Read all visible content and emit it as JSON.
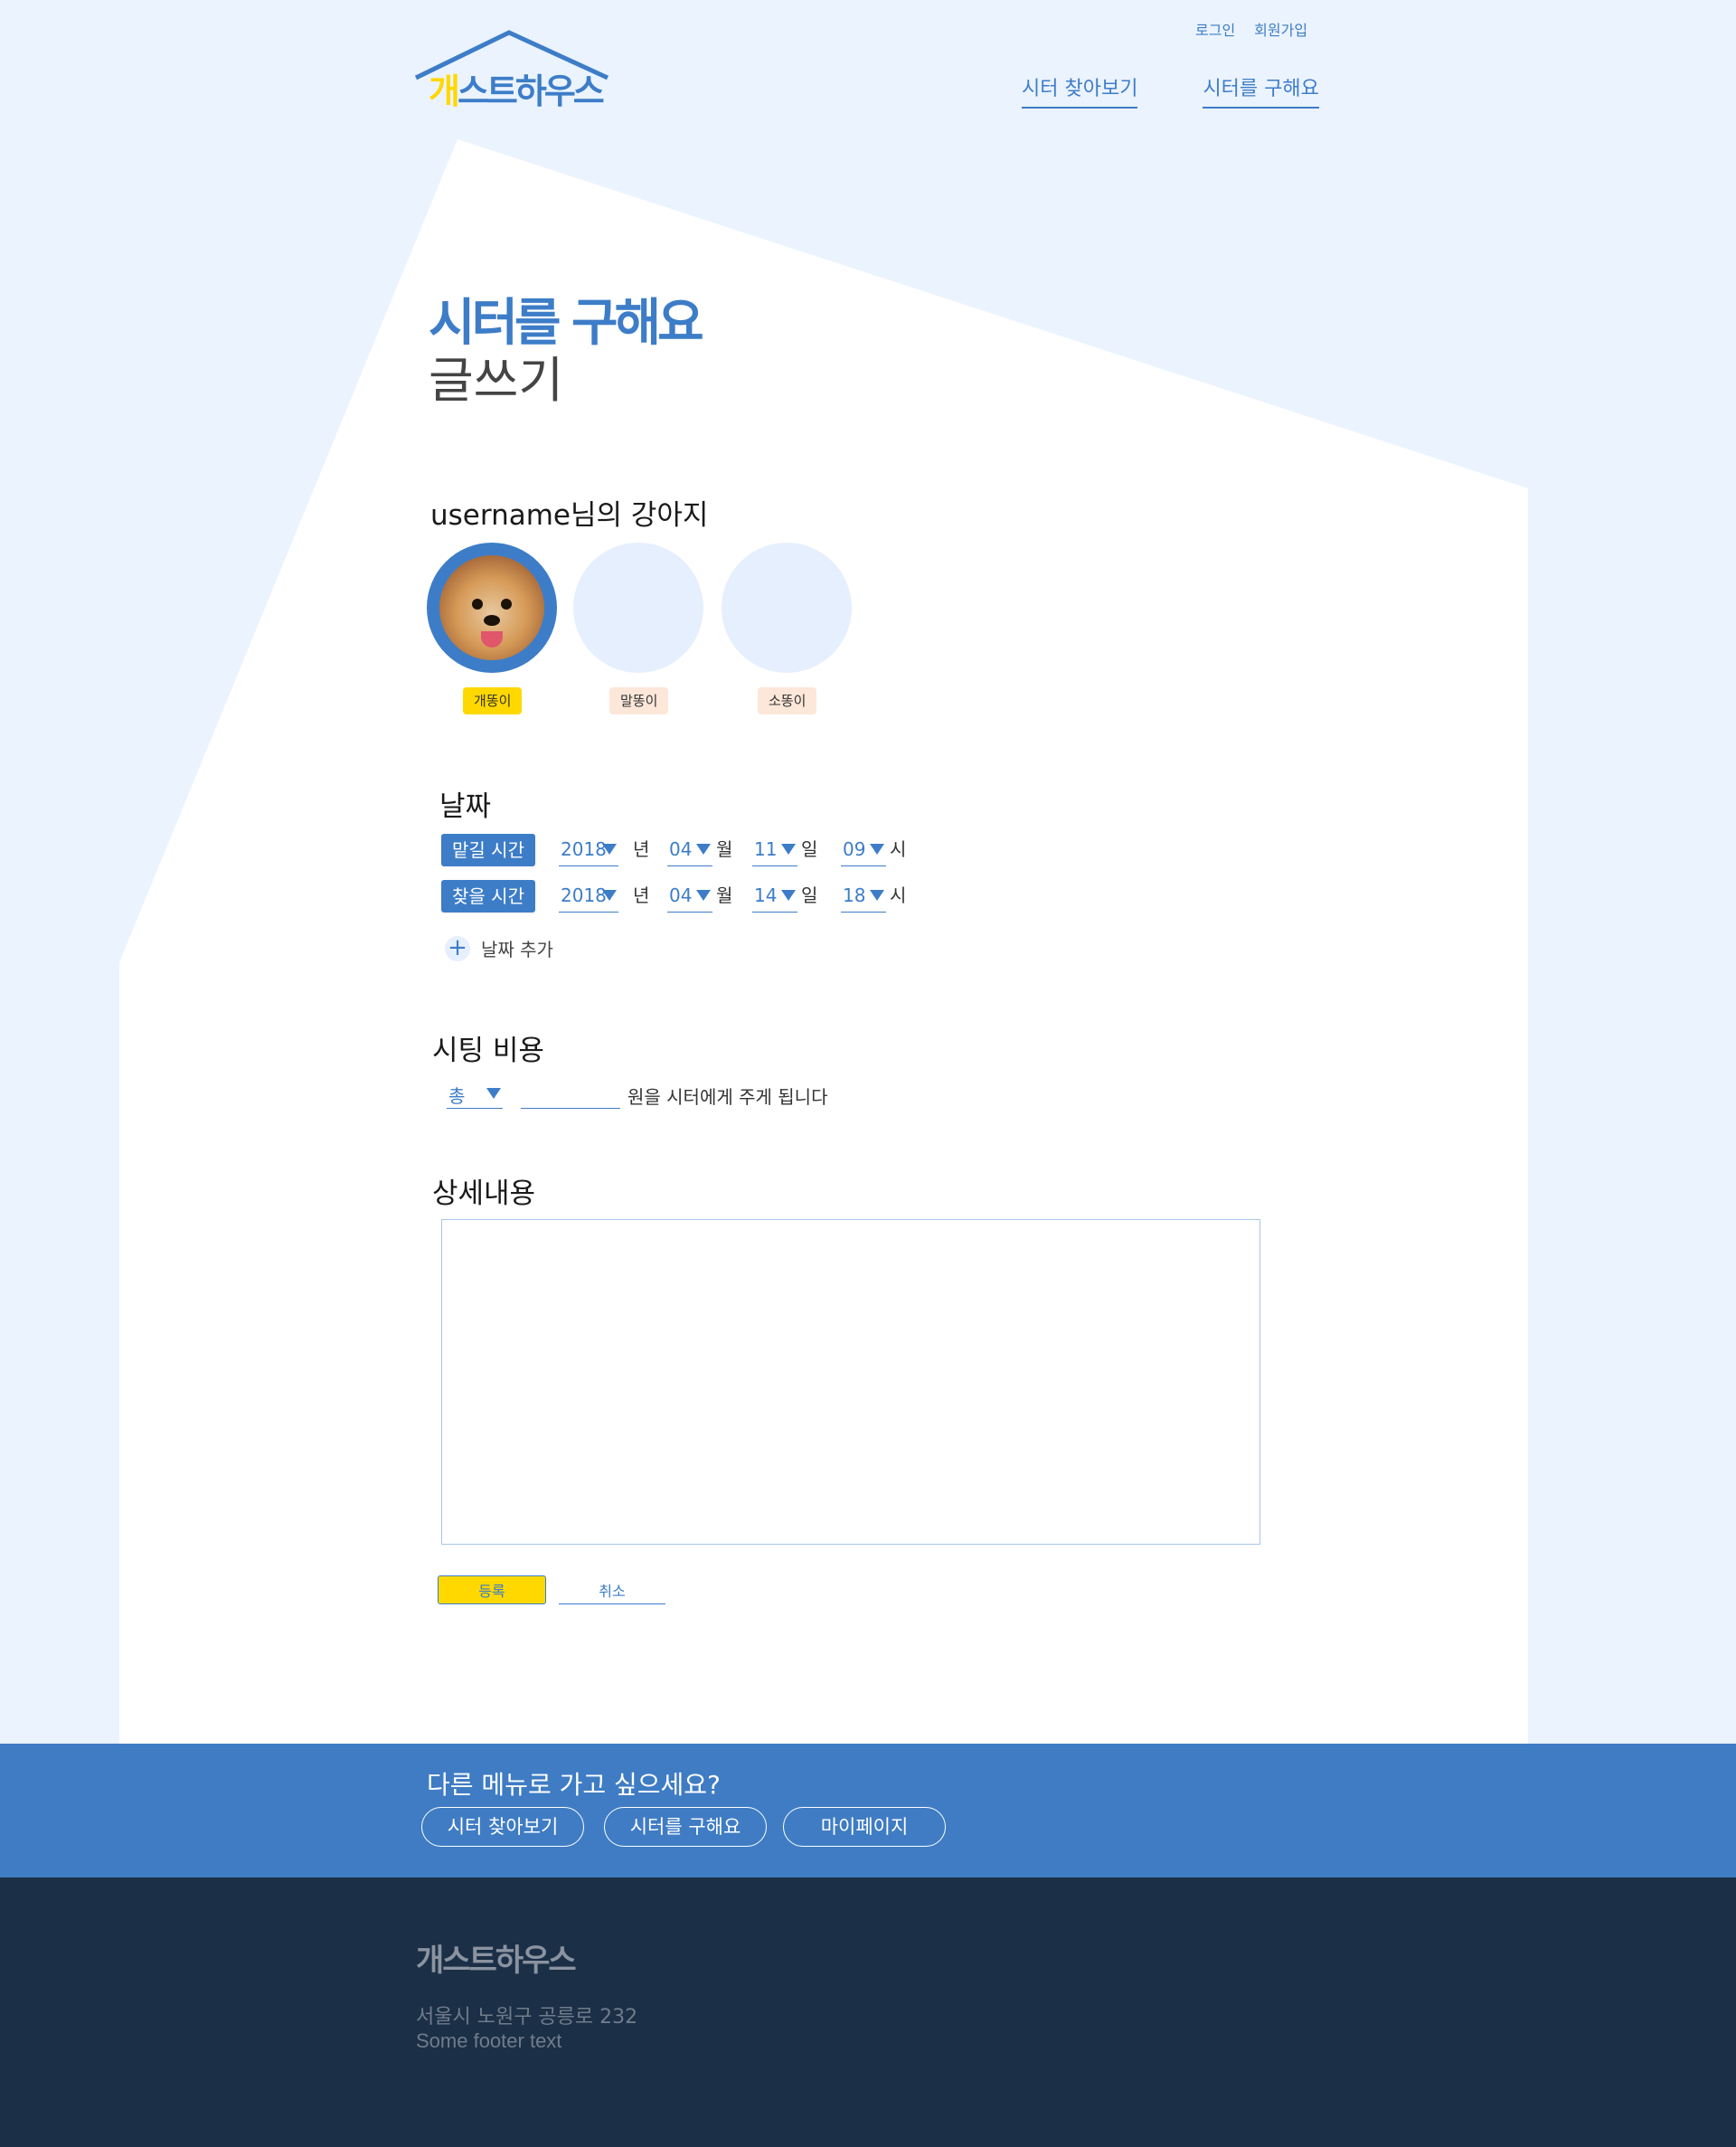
{
  "brand": {
    "logo_text_first": "개",
    "logo_text_rest": "스트하우스",
    "color_primary": "#3d7dc8",
    "color_accent": "#ffd800"
  },
  "top_links": {
    "login": "로그인",
    "signup": "회원가입"
  },
  "nav": {
    "find_sitter": "시터 찾아보기",
    "need_sitter": "시터를 구해요"
  },
  "page": {
    "title": "시터를 구해요",
    "subtitle": "글쓰기"
  },
  "dogs_section": {
    "title": "username님의 강아지",
    "dogs": [
      {
        "name": "개똥이",
        "selected": true,
        "icon": "pomeranian-photo"
      },
      {
        "name": "말똥이",
        "selected": false
      },
      {
        "name": "소똥이",
        "selected": false
      }
    ]
  },
  "date_section": {
    "title": "날짜",
    "rows": [
      {
        "label": "맡길 시간",
        "year": "2018",
        "month": "04",
        "day": "11",
        "hour": "09"
      },
      {
        "label": "찾을 시간",
        "year": "2018",
        "month": "04",
        "day": "14",
        "hour": "18"
      }
    ],
    "units": {
      "year": "년",
      "month": "월",
      "day": "일",
      "hour": "시"
    },
    "add_label": "날짜 추가"
  },
  "cost_section": {
    "title": "시팅 비용",
    "select_value": "총",
    "input_value": "",
    "suffix_text": "원을 시터에게 주게 됩니다"
  },
  "detail_section": {
    "title": "상세내용",
    "value": ""
  },
  "actions": {
    "submit": "등록",
    "cancel": "취소"
  },
  "menu_band": {
    "question": "다른 메뉴로 가고 싶으세요?",
    "buttons": [
      "시터 찾아보기",
      "시터를 구해요",
      "마이페이지"
    ]
  },
  "footer": {
    "logo": "개스트하우스",
    "address": "서울시 노원구 공릉로 232",
    "text": "Some footer text"
  }
}
